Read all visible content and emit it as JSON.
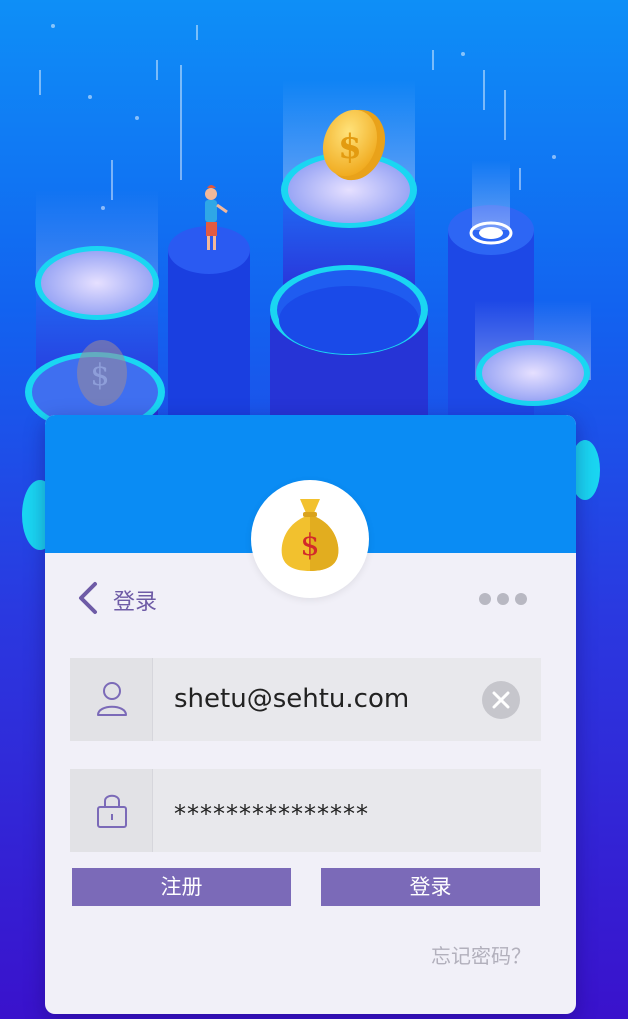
{
  "colors": {
    "background_top": "#0e8ff7",
    "background_bottom": "#3a12cc",
    "card_header": "#0a8cf4",
    "card_body": "#f1f0f8",
    "accent_purple": "#7b6ab8",
    "coin_gold": "#f2c12e"
  },
  "illustration": {
    "coin_symbol": "$",
    "bag_symbol": "$"
  },
  "header": {
    "icon": "money-bag-icon"
  },
  "nav": {
    "back_icon": "chevron-left-icon",
    "title": "登录",
    "more_icon": "more-dots-icon"
  },
  "form": {
    "username": {
      "icon": "user-icon",
      "value": "shetu@sehtu.com",
      "clear_icon": "clear-x-icon"
    },
    "password": {
      "icon": "lock-icon",
      "value": "***************"
    }
  },
  "buttons": {
    "register_label": "注册",
    "login_label": "登录"
  },
  "forgot_password": "忘记密码？"
}
